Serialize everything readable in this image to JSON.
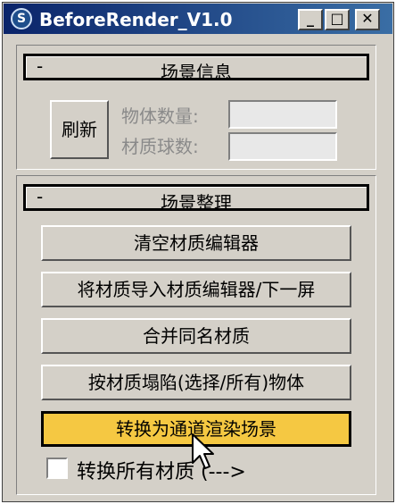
{
  "window": {
    "title": "BeforeRender_V1.0",
    "icon": "3dsmax-app-icon",
    "controls": {
      "minimize": "_",
      "maximize": "□",
      "close": "✕"
    }
  },
  "scene_info": {
    "collapse_symbol": "-",
    "title": "场景信息",
    "refresh_label": "刷新",
    "object_count_label": "物体数量:",
    "object_count_value": "",
    "material_count_label": "材质球数:",
    "material_count_value": ""
  },
  "scene_cleanup": {
    "collapse_symbol": "-",
    "title": "场景整理",
    "buttons": [
      "清空材质编辑器",
      "将材质导入材质编辑器/下一屏",
      "合并同名材质",
      "按材质塌陷(选择/所有)物体",
      "转换为通道渲染场景"
    ],
    "highlight_color": "#f5c842",
    "convert_all_label": "转换所有材质 (--->",
    "convert_all_checked": false
  }
}
